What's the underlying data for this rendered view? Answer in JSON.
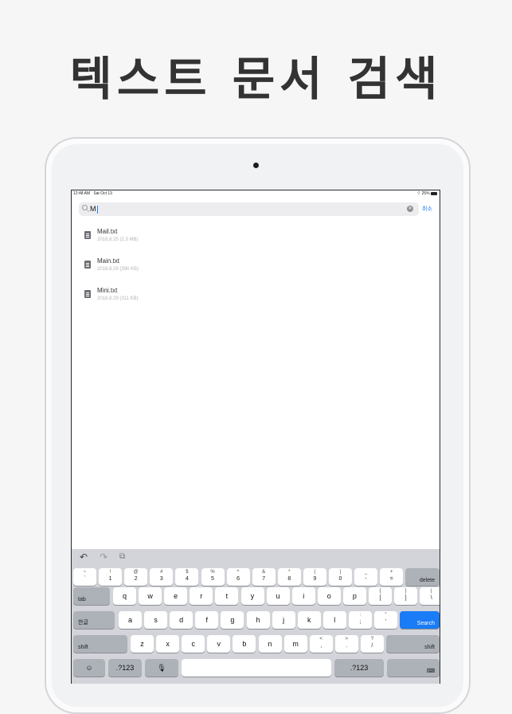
{
  "headline": "텍스트 문서 검색",
  "status_bar": {
    "time": "12:48 AM",
    "date": "Sat Oct 13",
    "battery": "25%"
  },
  "search": {
    "value": "M",
    "cancel_label": "취소"
  },
  "files": [
    {
      "name": "Mail.txt",
      "meta": "2018.8.25 (2.3 MB)"
    },
    {
      "name": "Main.txt",
      "meta": "2018.8.29 (390 KB)"
    },
    {
      "name": "Mini.txt",
      "meta": "2018.8.29 (311 KB)"
    }
  ],
  "keyboard": {
    "number_row": [
      {
        "top": "~",
        "bottom": "`"
      },
      {
        "top": "!",
        "bottom": "1"
      },
      {
        "top": "@",
        "bottom": "2"
      },
      {
        "top": "#",
        "bottom": "3"
      },
      {
        "top": "$",
        "bottom": "4"
      },
      {
        "top": "%",
        "bottom": "5"
      },
      {
        "top": "^",
        "bottom": "6"
      },
      {
        "top": "&",
        "bottom": "7"
      },
      {
        "top": "*",
        "bottom": "8"
      },
      {
        "top": "(",
        "bottom": "9"
      },
      {
        "top": ")",
        "bottom": "0"
      },
      {
        "top": "_",
        "bottom": "-"
      },
      {
        "top": "+",
        "bottom": "="
      }
    ],
    "delete_label": "delete",
    "tab_label": "tab",
    "row_q": [
      "q",
      "w",
      "e",
      "r",
      "t",
      "y",
      "u",
      "i",
      "o",
      "p"
    ],
    "row_q_extra": [
      {
        "top": "{",
        "bottom": "["
      },
      {
        "top": "}",
        "bottom": "]"
      },
      {
        "top": "|",
        "bottom": "\\"
      }
    ],
    "lang_label": "한글",
    "row_a": [
      "a",
      "s",
      "d",
      "f",
      "g",
      "h",
      "j",
      "k",
      "l"
    ],
    "row_a_extra": [
      {
        "top": ":",
        "bottom": ";"
      },
      {
        "top": "\"",
        "bottom": "'"
      }
    ],
    "search_label": "Search",
    "shift_label": "shift",
    "row_z": [
      "z",
      "x",
      "c",
      "v",
      "b",
      "n",
      "m"
    ],
    "row_z_extra": [
      {
        "top": "<",
        "bottom": ","
      },
      {
        "top": ">",
        "bottom": "."
      },
      {
        "top": "?",
        "bottom": "/"
      }
    ],
    "numbers_label": ".?123",
    "toolbar_icons": [
      "undo-icon",
      "redo-icon",
      "paste-icon"
    ]
  }
}
